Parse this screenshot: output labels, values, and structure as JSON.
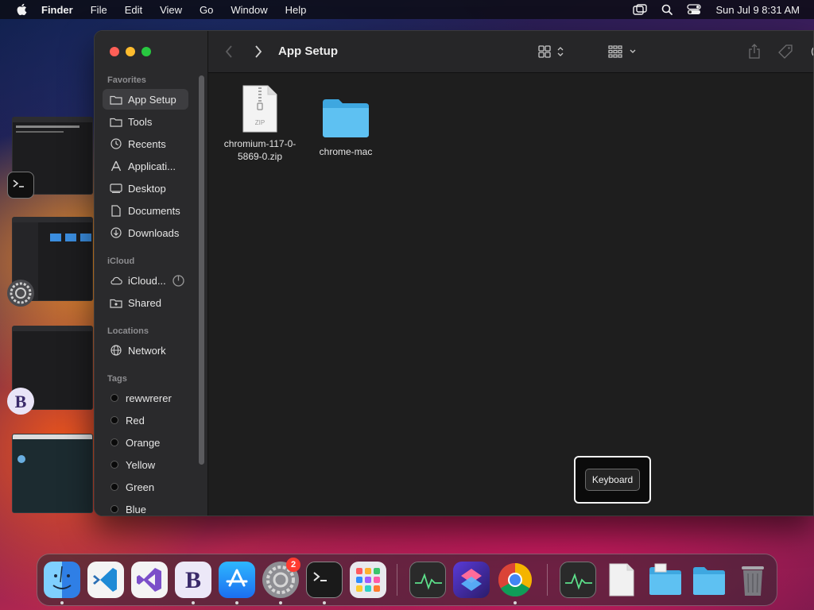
{
  "menubar": {
    "app_name": "Finder",
    "items": [
      "File",
      "Edit",
      "View",
      "Go",
      "Window",
      "Help"
    ],
    "clock": "Sun Jul 9  8:31 AM"
  },
  "finder": {
    "title": "App Setup",
    "sidebar": {
      "favorites_header": "Favorites",
      "favorites": [
        {
          "label": "App Setup",
          "icon": "folder-icon"
        },
        {
          "label": "Tools",
          "icon": "folder-icon"
        },
        {
          "label": "Recents",
          "icon": "clock-icon"
        },
        {
          "label": "Applicati...",
          "icon": "applications-icon"
        },
        {
          "label": "Desktop",
          "icon": "desktop-icon"
        },
        {
          "label": "Documents",
          "icon": "document-icon"
        },
        {
          "label": "Downloads",
          "icon": "download-icon"
        }
      ],
      "icloud_header": "iCloud",
      "icloud": [
        {
          "label": "iCloud...",
          "icon": "cloud-icon"
        },
        {
          "label": "Shared",
          "icon": "shared-folder-icon"
        }
      ],
      "locations_header": "Locations",
      "locations": [
        {
          "label": "Network",
          "icon": "globe-icon"
        }
      ],
      "tags_header": "Tags",
      "tags": [
        "rewwrerer",
        "Red",
        "Orange",
        "Yellow",
        "Green",
        "Blue"
      ]
    },
    "files": [
      {
        "name_line1": "chromium-117-0-",
        "name_line2": "5869-0.zip",
        "icon": "zip-file-icon",
        "icon_text": "ZIP"
      },
      {
        "name_line1": "chrome-mac",
        "name_line2": "",
        "icon": "folder-icon"
      }
    ]
  },
  "keyboard_popup": {
    "label": "Keyboard"
  },
  "dock": {
    "system_settings_badge": "2",
    "apps": [
      "Finder",
      "Visual Studio Code",
      "Visual Studio",
      "BBEdit",
      "App Store",
      "System Settings",
      "Terminal",
      "Launchpad",
      "Activity Monitor",
      "Shortcuts",
      "Google Chrome",
      "Activity Monitor",
      "Document",
      "Folder",
      "Folder",
      "Trash"
    ]
  },
  "colors": {
    "traffic_red": "#ff5f57",
    "traffic_yellow": "#febc2e",
    "traffic_green": "#28c840",
    "folder_blue": "#5ec1f2"
  }
}
